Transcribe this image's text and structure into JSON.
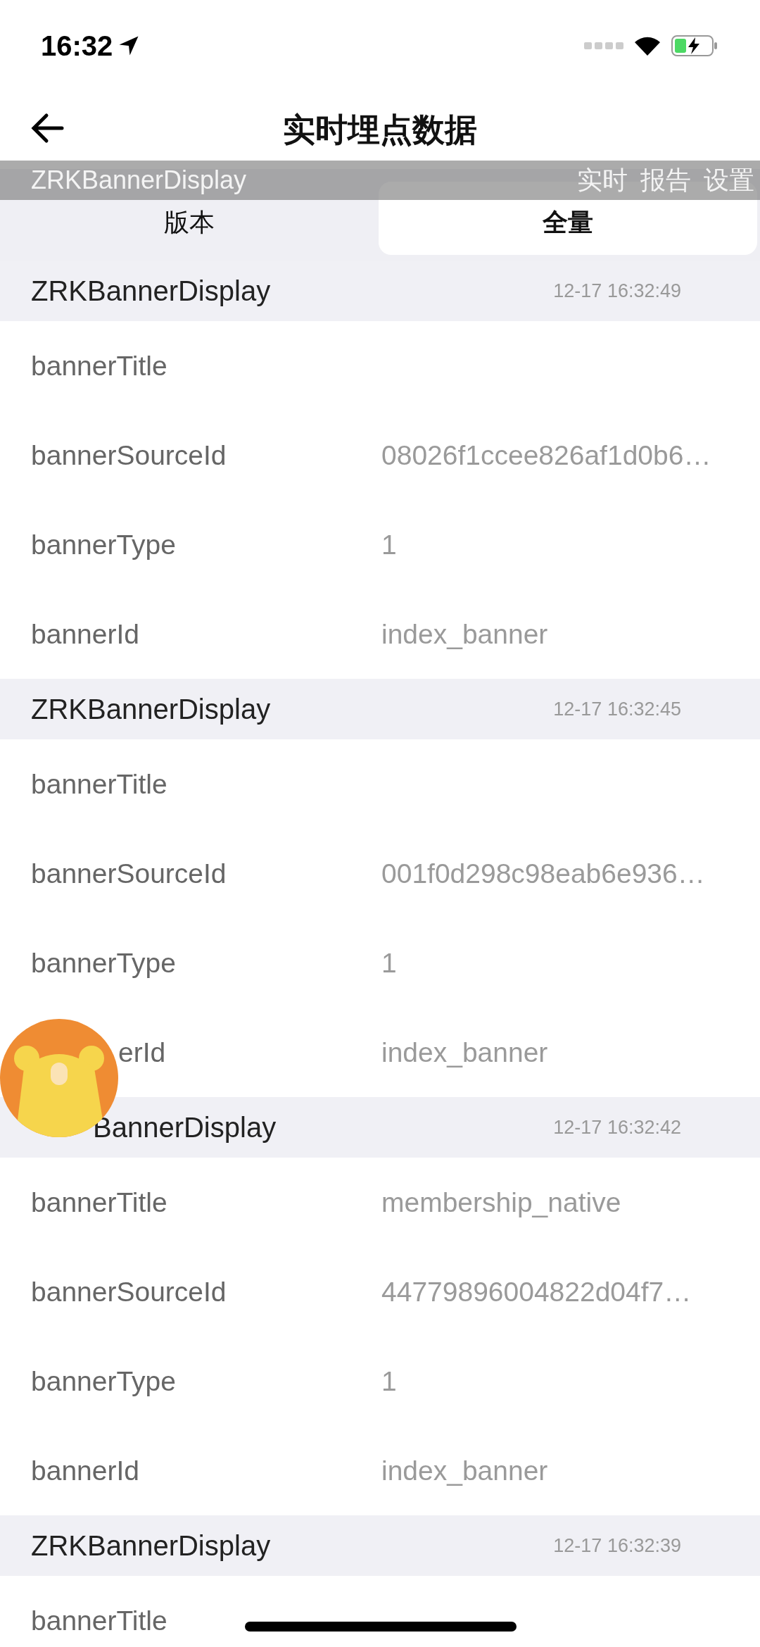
{
  "status_bar": {
    "time": "16:32"
  },
  "nav": {
    "title": "实时埋点数据"
  },
  "overlay": {
    "event": "ZRKBannerDisplay",
    "actions": [
      "实时",
      "报告",
      "设置"
    ]
  },
  "tabs": [
    {
      "label": "版本",
      "selected": false
    },
    {
      "label": "全量",
      "selected": true
    }
  ],
  "events": [
    {
      "name": "ZRKBannerDisplay",
      "time": "12-17 16:32:49",
      "params": [
        {
          "key": "bannerTitle"
        },
        {
          "key": "bannerSourceId",
          "value": "08026f1ccee826af1d0b6…"
        },
        {
          "key": "bannerType",
          "value": "1"
        },
        {
          "key": "bannerId",
          "value": "index_banner"
        }
      ]
    },
    {
      "name": "ZRKBannerDisplay",
      "time": "12-17 16:32:45",
      "params": [
        {
          "key": "bannerTitle"
        },
        {
          "key": "bannerSourceId",
          "value": "001f0d298c98eab6e936…"
        },
        {
          "key": "bannerType",
          "value": "1"
        },
        {
          "key": "erId",
          "value": "index_banner",
          "partly_hidden": true
        }
      ]
    },
    {
      "name": "BannerDisplay",
      "partly_hidden": true,
      "time": "12-17 16:32:42",
      "params": [
        {
          "key": "bannerTitle",
          "value": "membership_native"
        },
        {
          "key": "bannerSourceId",
          "value": "44779896004822d04f7…"
        },
        {
          "key": "bannerType",
          "value": "1"
        },
        {
          "key": "bannerId",
          "value": "index_banner"
        }
      ]
    },
    {
      "name": "ZRKBannerDisplay",
      "time": "12-17 16:32:39",
      "params": [
        {
          "key": "bannerTitle"
        }
      ]
    }
  ]
}
